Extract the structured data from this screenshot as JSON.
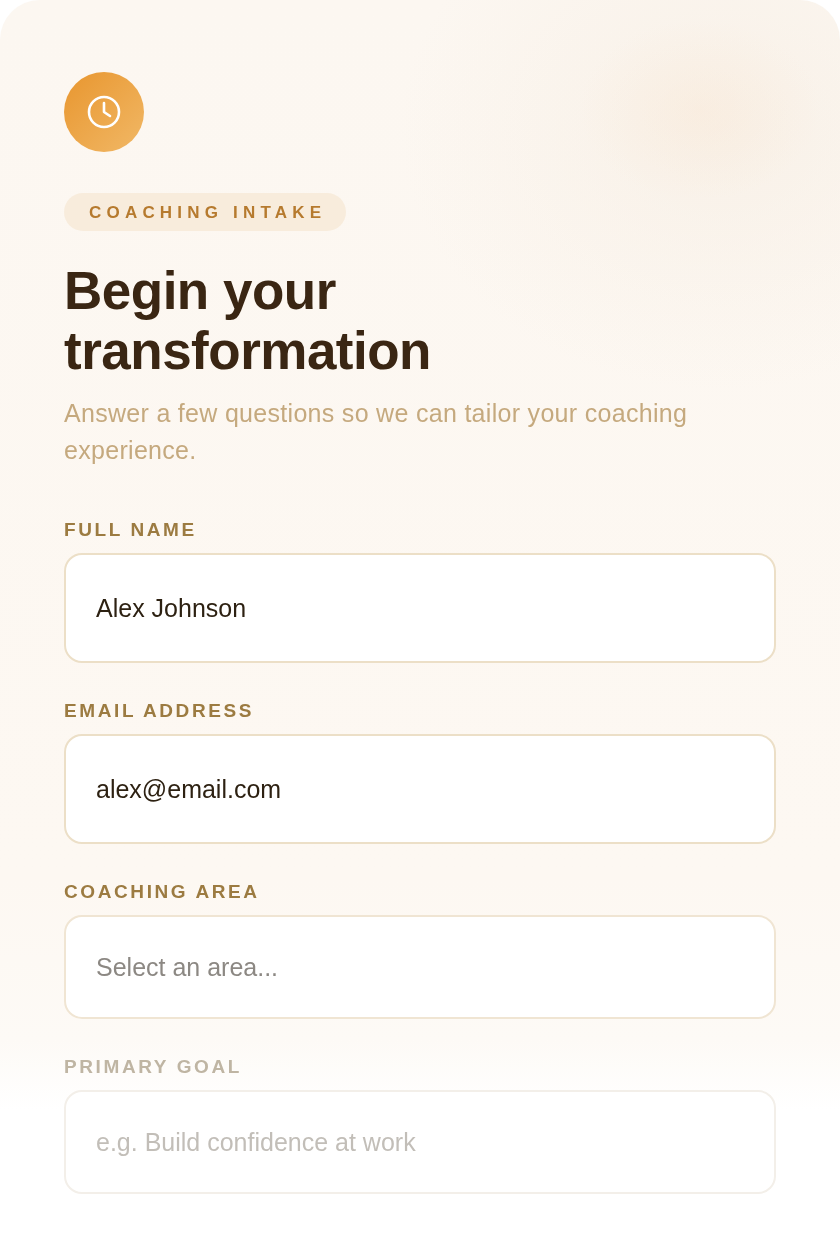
{
  "header": {
    "badge": "COACHING INTAKE",
    "title": "Begin your transformation",
    "subtitle": "Answer a few questions so we can tailor your coaching experience."
  },
  "fields": [
    {
      "kind": "text",
      "label": "FULL NAME",
      "value": "Alex Johnson",
      "faded": false
    },
    {
      "kind": "email",
      "label": "EMAIL ADDRESS",
      "value": "alex@email.com",
      "faded": false
    },
    {
      "kind": "select",
      "label": "COACHING AREA",
      "placeholder": "Select an area...",
      "faded": false
    },
    {
      "kind": "text",
      "label": "PRIMARY GOAL",
      "placeholder": "e.g. Build confidence at work",
      "faded": true
    }
  ]
}
